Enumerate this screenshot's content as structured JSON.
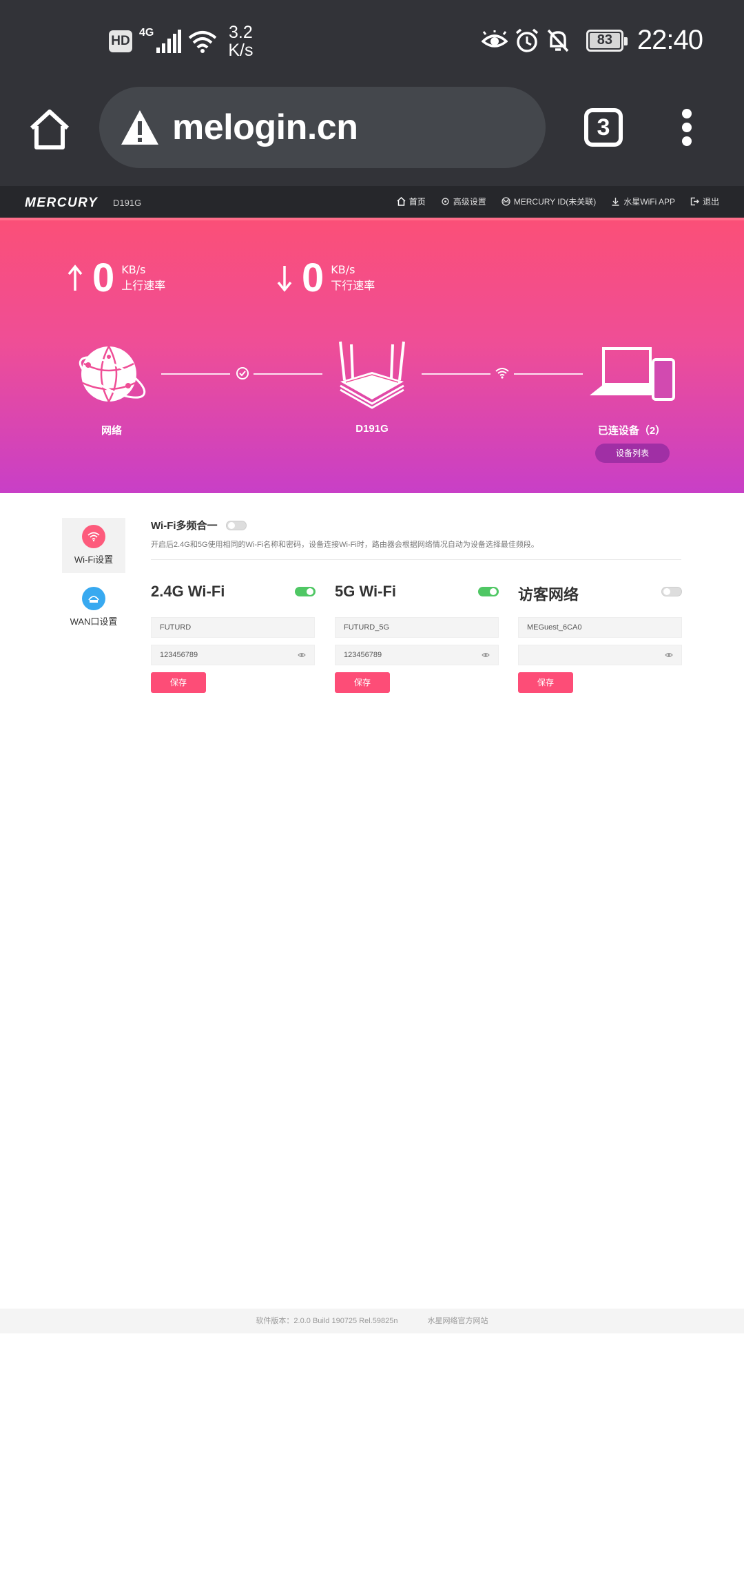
{
  "statusbar": {
    "hd": "HD",
    "network_type": "4G",
    "speed_value": "3.2",
    "speed_unit": "K/s",
    "battery": "83",
    "time": "22:40"
  },
  "browser": {
    "url": "melogin.cn",
    "tab_count": "3"
  },
  "app": {
    "brand": "MERCURY",
    "model": "D191G",
    "nav": [
      {
        "label": "首页",
        "icon": "home-icon"
      },
      {
        "label": "高级设置",
        "icon": "gear-icon"
      },
      {
        "label": "MERCURY ID(未关联)",
        "icon": "mercury-id-icon"
      },
      {
        "label": "水星WiFi APP",
        "icon": "download-icon"
      },
      {
        "label": "退出",
        "icon": "logout-icon"
      }
    ]
  },
  "hero": {
    "upload": {
      "value": "0",
      "unit": "KB/s",
      "label": "上行速率"
    },
    "download": {
      "value": "0",
      "unit": "KB/s",
      "label": "下行速率"
    },
    "network_label": "网络",
    "router_label": "D191G",
    "devices_label": "已连设备（2）",
    "device_list_button": "设备列表"
  },
  "sidebar": {
    "items": [
      {
        "label": "Wi-Fi设置",
        "icon": "wifi-icon",
        "color": "#fd5b7c",
        "active": true
      },
      {
        "label": "WAN口设置",
        "icon": "wan-icon",
        "color": "#38a9f0",
        "active": false
      }
    ]
  },
  "wifi": {
    "merge_title": "Wi-Fi多频合一",
    "merge_desc": "开启后2.4G和5G使用相同的Wi-Fi名称和密码，设备连接Wi-Fi时，路由器会根据网络情况自动为设备选择最佳频段。",
    "cards": [
      {
        "title": "2.4G Wi-Fi",
        "ssid": "FUTURD",
        "password": "123456789",
        "enabled": true,
        "save_label": "保存"
      },
      {
        "title": "5G Wi-Fi",
        "ssid": "FUTURD_5G",
        "password": "123456789",
        "enabled": true,
        "save_label": "保存"
      },
      {
        "title": "访客网络",
        "ssid": "MEGuest_6CA0",
        "password": "",
        "enabled": false,
        "save_label": "保存"
      }
    ]
  },
  "footer": {
    "version": "软件版本：2.0.0 Build 190725 Rel.59825n",
    "site": "水星网络官方网站"
  },
  "colors": {
    "accent": "#fd4d77",
    "toggle_on": "#4fc764",
    "hero_top": "#fb4f77",
    "hero_bottom": "#c83fc7"
  }
}
